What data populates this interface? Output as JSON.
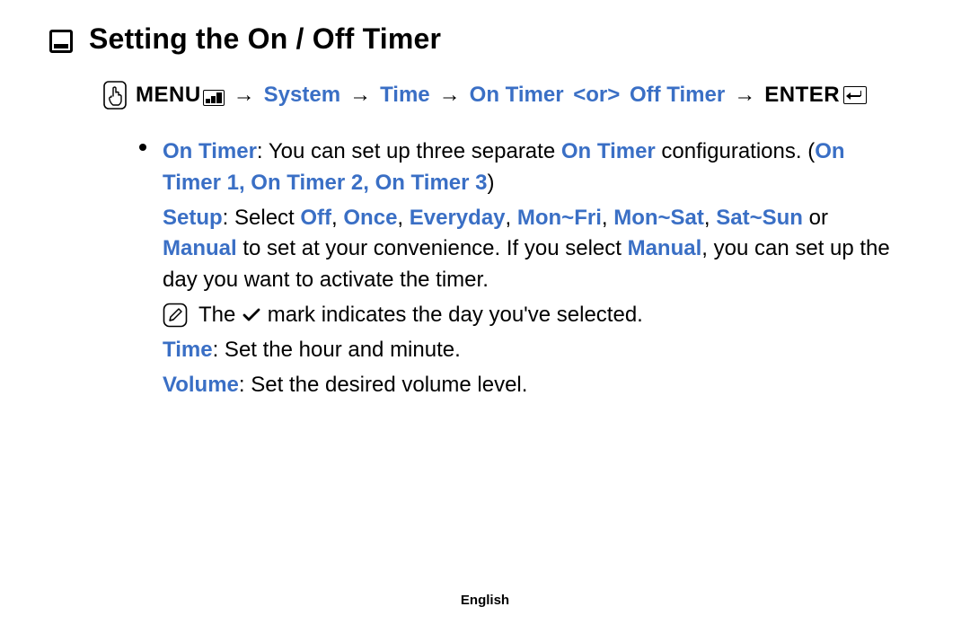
{
  "heading": "Setting the On / Off Timer",
  "nav": {
    "menu": "MENU",
    "system": "System",
    "time": "Time",
    "on_timer": "On Timer",
    "or": "<or>",
    "off_timer": "Off Timer",
    "enter": "ENTER",
    "arrow": "→"
  },
  "body": {
    "on_timer_label": "On Timer",
    "on_timer_desc1": ": You can set up three separate ",
    "on_timer_desc2": " configurations. (",
    "on_timer_1": "On Timer 1",
    "sep": ", ",
    "on_timer_2": "On Timer 2",
    "on_timer_3": "On Timer 3",
    "close_paren": ")",
    "setup_label": "Setup",
    "setup_desc1": ": Select ",
    "opt_off": "Off",
    "opt_once": "Once",
    "opt_everyday": "Everyday",
    "opt_monfri": "Mon~Fri",
    "opt_monsat": "Mon~Sat",
    "opt_satsun": "Sat~Sun",
    "or_word": " or ",
    "opt_manual": "Manual",
    "setup_desc2": " to set at your convenience. If you select ",
    "setup_desc3": ", you can set up the day you want to activate the timer.",
    "note_pre": "The ",
    "note_post": " mark indicates the day you've selected.",
    "time_label": "Time",
    "time_desc": ": Set the hour and minute.",
    "volume_label": "Volume",
    "volume_desc": ": Set the desired volume level."
  },
  "footer": "English"
}
